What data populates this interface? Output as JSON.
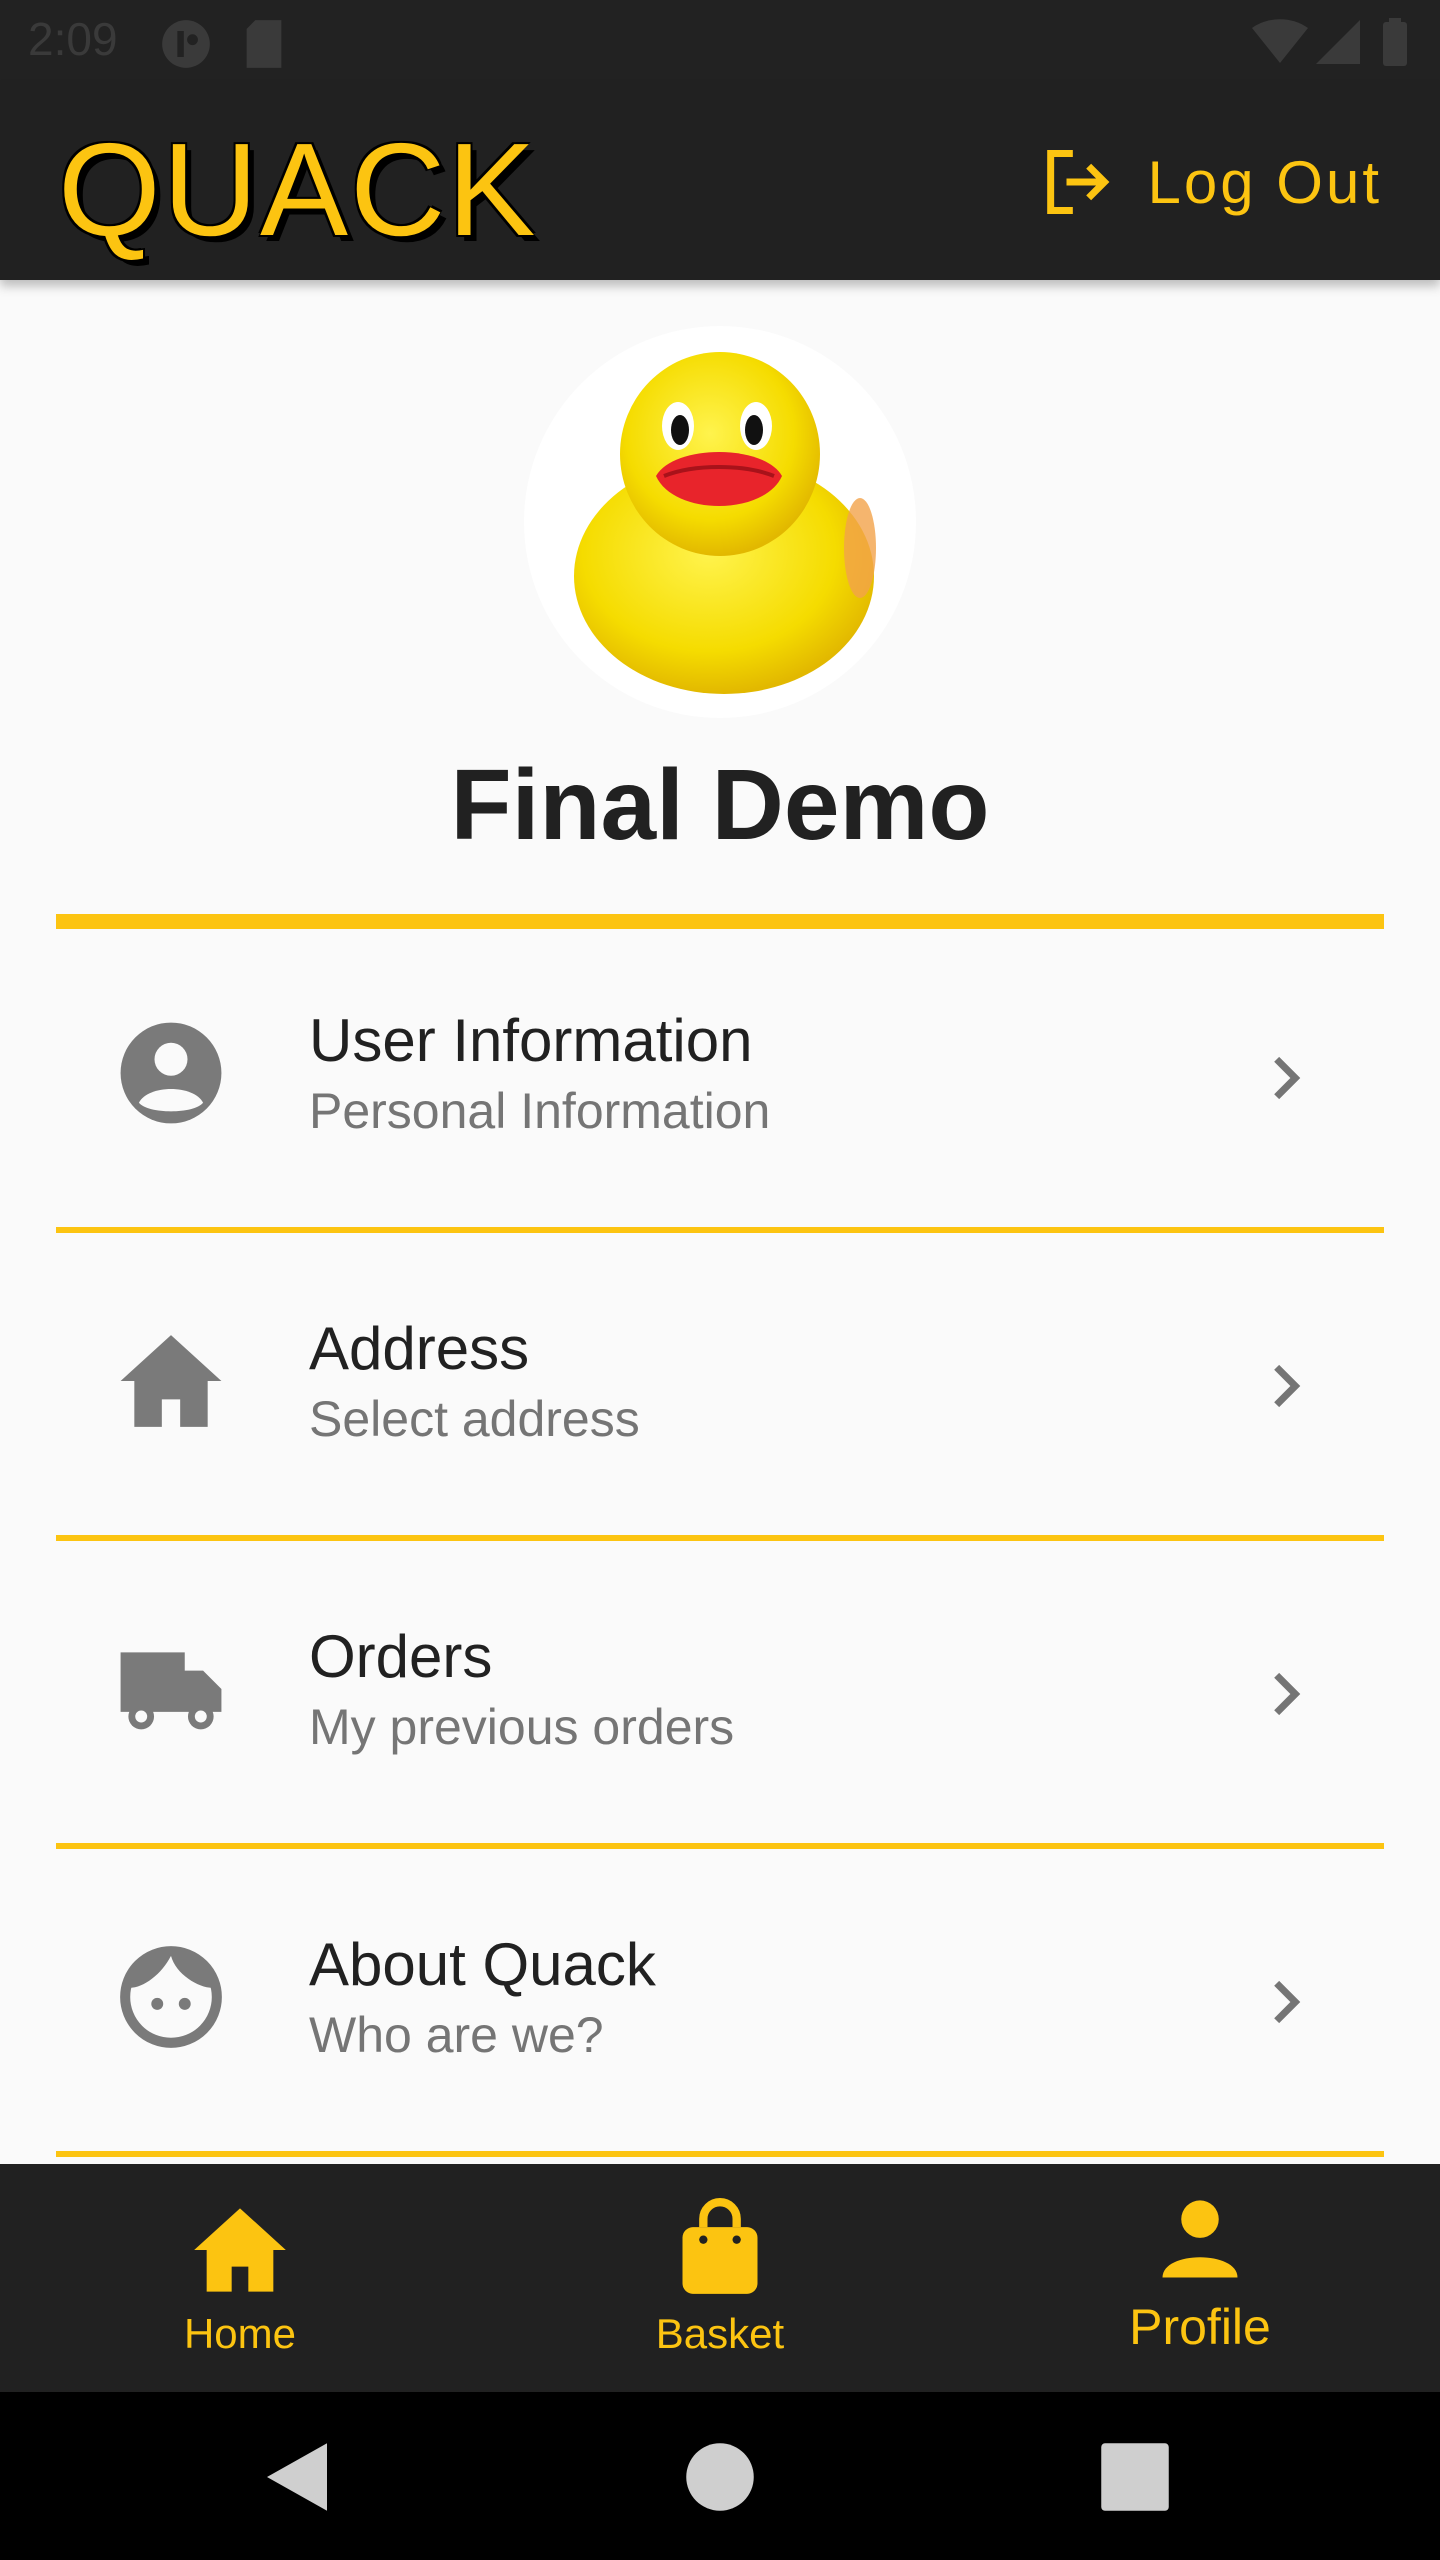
{
  "status_bar": {
    "time": "2:09",
    "icons_left": [
      "notification-badge-icon",
      "sd-card-icon"
    ],
    "icons_right": [
      "wifi-icon",
      "cellular-signal-icon",
      "battery-icon"
    ]
  },
  "app_bar": {
    "logo_text": "QUACK",
    "logout_label": "Log Out",
    "logout_icon": "logout-icon"
  },
  "profile": {
    "avatar": "rubber-duck-avatar",
    "name": "Final Demo"
  },
  "menu": {
    "items": [
      {
        "icon": "account-circle-icon",
        "title": "User Information",
        "subtitle": "Personal Information"
      },
      {
        "icon": "home-icon",
        "title": "Address",
        "subtitle": "Select address"
      },
      {
        "icon": "truck-icon",
        "title": "Orders",
        "subtitle": "My previous orders"
      },
      {
        "icon": "face-icon",
        "title": "About Quack",
        "subtitle": "Who are we?"
      }
    ]
  },
  "bottom_nav": {
    "items": [
      {
        "icon": "home-icon",
        "label": "Home"
      },
      {
        "icon": "shopping-bag-icon",
        "label": "Basket"
      },
      {
        "icon": "person-icon",
        "label": "Profile",
        "active": true
      }
    ]
  },
  "colors": {
    "accent": "#fcc411",
    "app_bar": "#212121",
    "background": "#fafafa",
    "icon_gray": "#7a7a7a"
  }
}
